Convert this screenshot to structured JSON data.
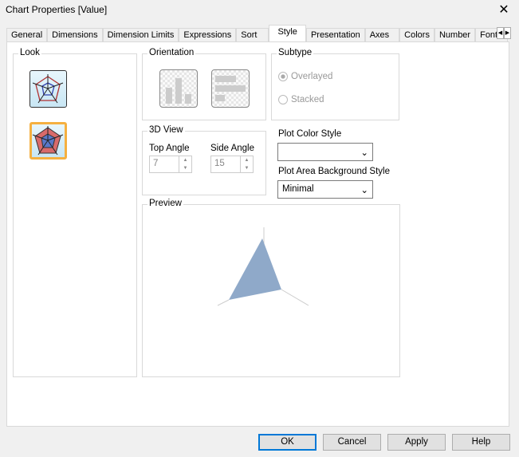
{
  "window": {
    "title": "Chart Properties [Value]",
    "close": "✕"
  },
  "tabs": [
    "General",
    "Dimensions",
    "Dimension Limits",
    "Expressions",
    "Sort",
    "Style",
    "Presentation",
    "Axes",
    "Colors",
    "Number",
    "Font"
  ],
  "active_tab": "Style",
  "look": {
    "label": "Look"
  },
  "orientation": {
    "label": "Orientation"
  },
  "subtype": {
    "label": "Subtype",
    "options": [
      "Overlayed",
      "Stacked"
    ],
    "selected": "Overlayed"
  },
  "view3d": {
    "label": "3D View",
    "top_angle_label": "Top Angle",
    "top_angle": "7",
    "side_angle_label": "Side Angle",
    "side_angle": "15"
  },
  "plot_color_style": {
    "label": "Plot Color Style",
    "value": ""
  },
  "plot_area_bg": {
    "label": "Plot Area Background Style",
    "value": "Minimal"
  },
  "preview": {
    "label": "Preview",
    "fill": "#8fa9c9"
  },
  "buttons": {
    "ok": "OK",
    "cancel": "Cancel",
    "apply": "Apply",
    "help": "Help"
  }
}
